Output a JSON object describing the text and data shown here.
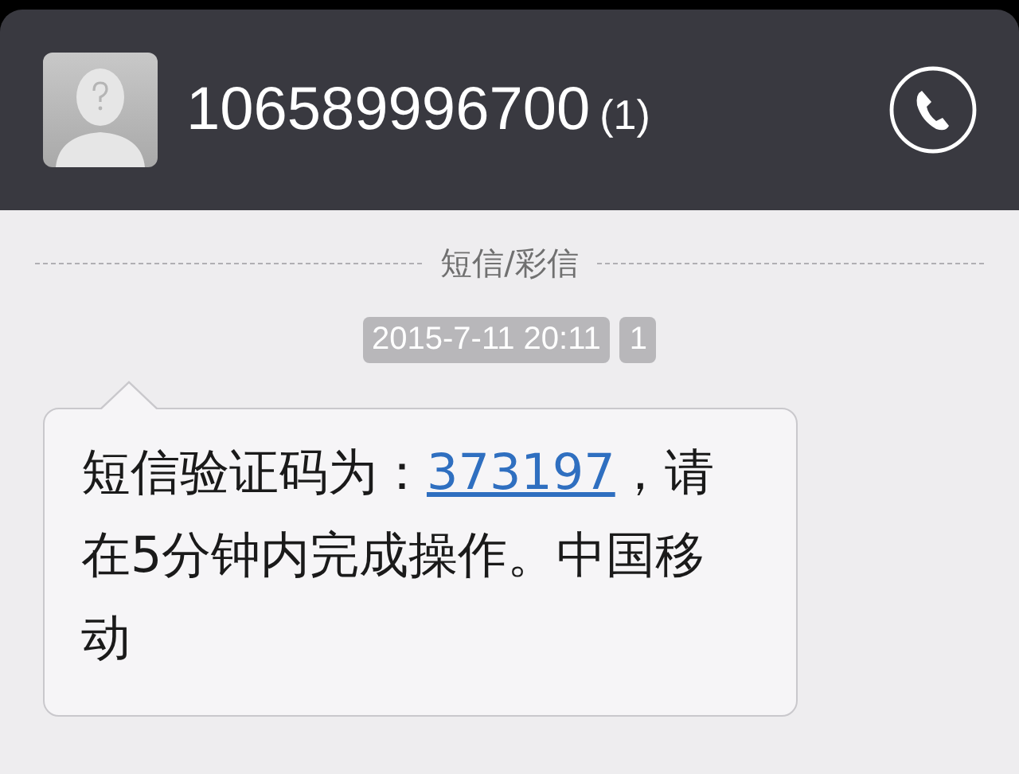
{
  "header": {
    "contact": "106589996700",
    "count": "(1)"
  },
  "divider": {
    "label": "短信/彩信"
  },
  "timestamp": {
    "time": "2015-7-11 20:11",
    "sim": "1"
  },
  "message": {
    "text_before": "短信验证码为：",
    "link": "373197",
    "text_after": "，请在5分钟内完成操作。中国移动"
  }
}
